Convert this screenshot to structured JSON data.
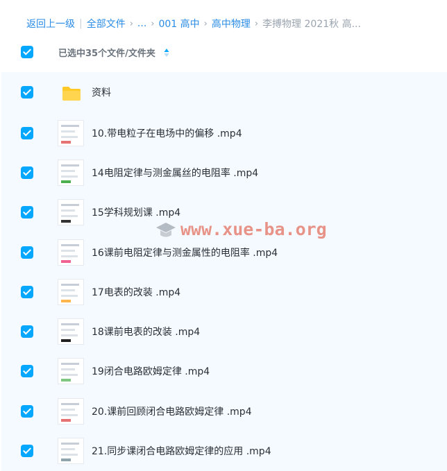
{
  "breadcrumb": {
    "back_label": "返回上一级",
    "items": [
      "全部文件",
      "...",
      "001 高中",
      "高中物理"
    ],
    "current": "李搏物理 2021秋 高..."
  },
  "header": {
    "selection_text": "已选中35个文件/文件夹"
  },
  "files": [
    {
      "name": "资料",
      "type": "folder"
    },
    {
      "name": "10.带电粒子在电场中的偏移 .mp4",
      "type": "video"
    },
    {
      "name": "14电阻定律与测金属丝的电阻率 .mp4",
      "type": "video"
    },
    {
      "name": "15学科规划课 .mp4",
      "type": "video"
    },
    {
      "name": "16课前电阻定律与测金属性的电阻率 .mp4",
      "type": "video"
    },
    {
      "name": "17电表的改装 .mp4",
      "type": "video"
    },
    {
      "name": "18课前电表的改装 .mp4",
      "type": "video"
    },
    {
      "name": "19闭合电路欧姆定律 .mp4",
      "type": "video"
    },
    {
      "name": "20.课前回顾闭合电路欧姆定律 .mp4",
      "type": "video"
    },
    {
      "name": "21.同步课闭合电路欧姆定律的应用 .mp4",
      "type": "video"
    }
  ],
  "watermark": {
    "text": "www.xue-ba.org"
  },
  "colors": {
    "accent": "#06a7ff",
    "link": "#2b8ce6",
    "folder": "#ffca28",
    "list_bg": "#f4faff",
    "watermark": "#e67a6a"
  }
}
